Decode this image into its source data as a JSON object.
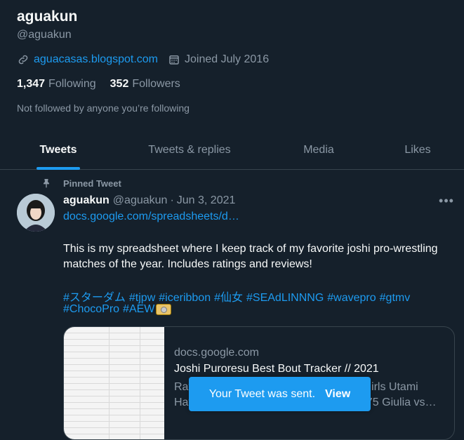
{
  "profile": {
    "display_name": "aguakun",
    "handle": "@aguakun",
    "website": "aguacasas.blogspot.com",
    "joined": "Joined July 2016",
    "following_count": "1,347",
    "following_label": "Following",
    "followers_count": "352",
    "followers_label": "Followers",
    "followed_by_note": "Not followed by anyone you’re following"
  },
  "tabs": [
    {
      "label": "Tweets",
      "active": true
    },
    {
      "label": "Tweets & replies",
      "active": false
    },
    {
      "label": "Media",
      "active": false
    },
    {
      "label": "Likes",
      "active": false
    }
  ],
  "tweet": {
    "pinned_label": "Pinned Tweet",
    "author_name": "aguakun",
    "author_handle": "@aguakun",
    "separator": "·",
    "date": "Jun 3, 2021",
    "link": "docs.google.com/spreadsheets/d…",
    "text": "This is my spreadsheet where I keep track of my favorite joshi pro-wrestling matches of the year. Includes ratings and reviews!",
    "hashtags_line1": [
      "#スターダム",
      "#tjpw",
      "#iceribbon",
      "#仙女",
      "#SEAdLINNNG",
      "#wavepro",
      "#gtmv"
    ],
    "hashtags_line2": [
      "#ChocoPro",
      "#AEW"
    ],
    "card": {
      "domain": "docs.google.com",
      "title": "Joshi Puroresu Best Bout Tracker // 2021",
      "description": "Rating Match Promotion Date Sendai Girls Utami Hayashishita vs. Mirai 6/12 Stardom 4.75 Giulia vs…"
    }
  },
  "toast": {
    "message": "Your Tweet was sent.",
    "action": "View"
  },
  "colors": {
    "background": "#15202b",
    "accent": "#1d9bf0",
    "muted_text": "#8b98a5",
    "border": "#38444d"
  }
}
